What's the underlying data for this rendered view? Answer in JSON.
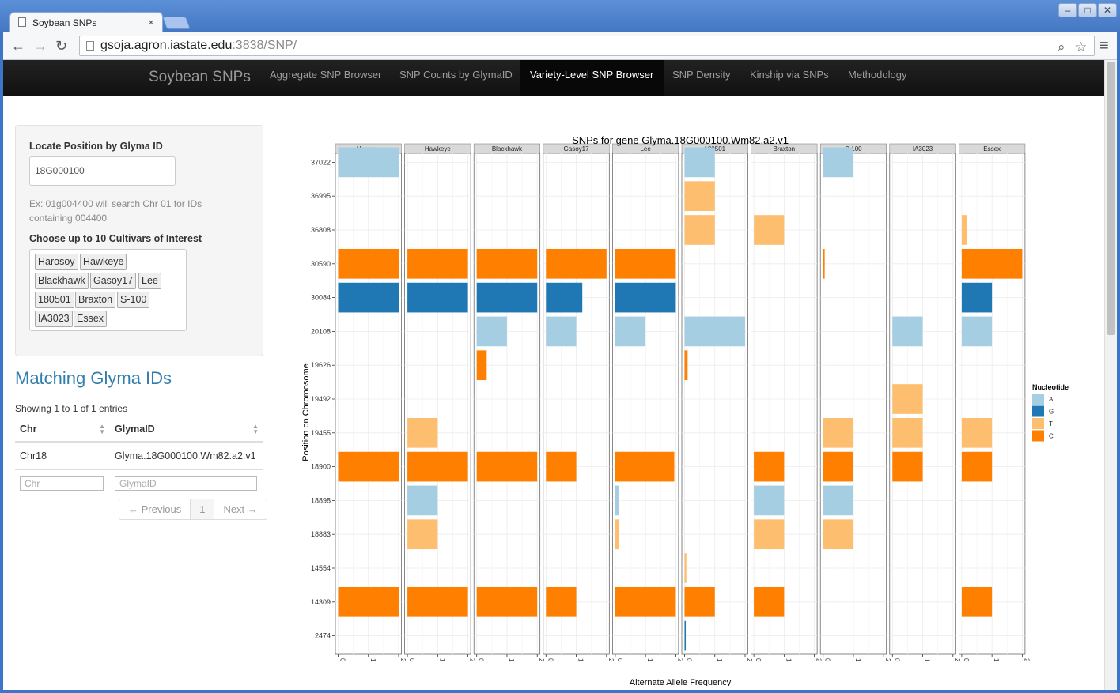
{
  "browser": {
    "tab_title": "Soybean SNPs",
    "url_host": "gsoja.agron.iastate.edu",
    "url_rest": ":3838/SNP/"
  },
  "navbar": {
    "brand": "Soybean SNPs",
    "items": [
      "Aggregate SNP Browser",
      "SNP Counts by GlymaID",
      "Variety-Level SNP Browser",
      "SNP Density",
      "Kinship via SNPs",
      "Methodology"
    ],
    "active": "Variety-Level SNP Browser"
  },
  "sidebar": {
    "locate_label": "Locate Position by Glyma ID",
    "glyma_input_value": "18G000100",
    "help_text": "Ex: 01g004400 will search Chr 01 for IDs containing 004400",
    "cultivar_label": "Choose up to 10 Cultivars of Interest",
    "cultivars": [
      "Harosoy",
      "Hawkeye",
      "Blackhawk",
      "Gasoy17",
      "Lee",
      "180501",
      "Braxton",
      "S-100",
      "IA3023",
      "Essex"
    ]
  },
  "matches": {
    "title": "Matching Glyma IDs",
    "showing": "Showing 1 to 1 of 1 entries",
    "columns": [
      "Chr",
      "GlymaID"
    ],
    "rows": [
      [
        "Chr18",
        "Glyma.18G000100.Wm82.a2.v1"
      ]
    ],
    "filter_placeholders": [
      "Chr",
      "GlymaID"
    ],
    "pager": {
      "prev": "← Previous",
      "page": "1",
      "next": "Next →"
    }
  },
  "chart_data": {
    "type": "bar",
    "title": "SNPs for gene Glyma.18G000100.Wm82.a2.v1",
    "xlabel": "Alternate Allele Frequency",
    "ylabel": "Position on Chromosome",
    "xlim": [
      0,
      2
    ],
    "xticks": [
      "0",
      "1",
      "2"
    ],
    "legend_title": "Nucleotide",
    "legend_position": "right",
    "nucleotide_colors": {
      "A": "#a6cee3",
      "G": "#1f78b4",
      "T": "#fdbf6f",
      "C": "#ff7f00"
    },
    "positions": [
      "37022",
      "36995",
      "36808",
      "30590",
      "30084",
      "20108",
      "19626",
      "19492",
      "19455",
      "18900",
      "18898",
      "18883",
      "14554",
      "14309",
      "2474"
    ],
    "panels": [
      {
        "name": "Harosoy",
        "bars": [
          [
            "37022",
            "A",
            2
          ],
          [
            "30590",
            "C",
            2
          ],
          [
            "30084",
            "G",
            2
          ],
          [
            "18900",
            "C",
            2
          ],
          [
            "14309",
            "C",
            2
          ]
        ]
      },
      {
        "name": "Hawkeye",
        "bars": [
          [
            "30590",
            "C",
            2
          ],
          [
            "30084",
            "G",
            2
          ],
          [
            "19455",
            "T",
            1
          ],
          [
            "18900",
            "C",
            2
          ],
          [
            "18898",
            "A",
            1
          ],
          [
            "18883",
            "T",
            1
          ],
          [
            "14309",
            "C",
            2
          ]
        ]
      },
      {
        "name": "Blackhawk",
        "bars": [
          [
            "30590",
            "C",
            2
          ],
          [
            "30084",
            "G",
            2
          ],
          [
            "20108",
            "A",
            1
          ],
          [
            "19626",
            "C",
            0.33
          ],
          [
            "18900",
            "C",
            2
          ],
          [
            "14309",
            "C",
            2
          ]
        ]
      },
      {
        "name": "Gasoy17",
        "bars": [
          [
            "30590",
            "C",
            2
          ],
          [
            "30084",
            "G",
            1.2
          ],
          [
            "20108",
            "A",
            1
          ],
          [
            "18900",
            "C",
            1
          ],
          [
            "14309",
            "C",
            1
          ]
        ]
      },
      {
        "name": "Lee",
        "bars": [
          [
            "30590",
            "C",
            2
          ],
          [
            "30084",
            "G",
            2
          ],
          [
            "20108",
            "A",
            1
          ],
          [
            "18900",
            "C",
            1.95
          ],
          [
            "18898",
            "A",
            0.12
          ],
          [
            "18883",
            "T",
            0.12
          ],
          [
            "14309",
            "C",
            2
          ]
        ]
      },
      {
        "name": "180501",
        "bars": [
          [
            "37022",
            "A",
            1
          ],
          [
            "36995",
            "T",
            1
          ],
          [
            "36808",
            "T",
            1
          ],
          [
            "20108",
            "A",
            2
          ],
          [
            "19626",
            "C",
            0.1
          ],
          [
            "14554",
            "T",
            0.06
          ],
          [
            "14309",
            "C",
            1
          ],
          [
            "2474",
            "G",
            0.04
          ]
        ]
      },
      {
        "name": "Braxton",
        "bars": [
          [
            "36808",
            "T",
            1
          ],
          [
            "18900",
            "C",
            1
          ],
          [
            "18898",
            "A",
            1
          ],
          [
            "18883",
            "T",
            1
          ],
          [
            "14309",
            "C",
            1
          ]
        ]
      },
      {
        "name": "S-100",
        "bars": [
          [
            "37022",
            "A",
            1
          ],
          [
            "30590",
            "C",
            0.05
          ],
          [
            "19455",
            "T",
            1
          ],
          [
            "18900",
            "C",
            1
          ],
          [
            "18898",
            "A",
            1
          ],
          [
            "18883",
            "T",
            1
          ]
        ]
      },
      {
        "name": "IA3023",
        "bars": [
          [
            "20108",
            "A",
            1
          ],
          [
            "19492",
            "T",
            1
          ],
          [
            "19455",
            "T",
            1
          ],
          [
            "18900",
            "C",
            1
          ]
        ]
      },
      {
        "name": "Essex",
        "bars": [
          [
            "36808",
            "T",
            0.18
          ],
          [
            "30590",
            "C",
            2
          ],
          [
            "30084",
            "G",
            1
          ],
          [
            "20108",
            "A",
            1
          ],
          [
            "19455",
            "T",
            1
          ],
          [
            "18900",
            "C",
            1
          ],
          [
            "14309",
            "C",
            1
          ]
        ]
      }
    ]
  }
}
